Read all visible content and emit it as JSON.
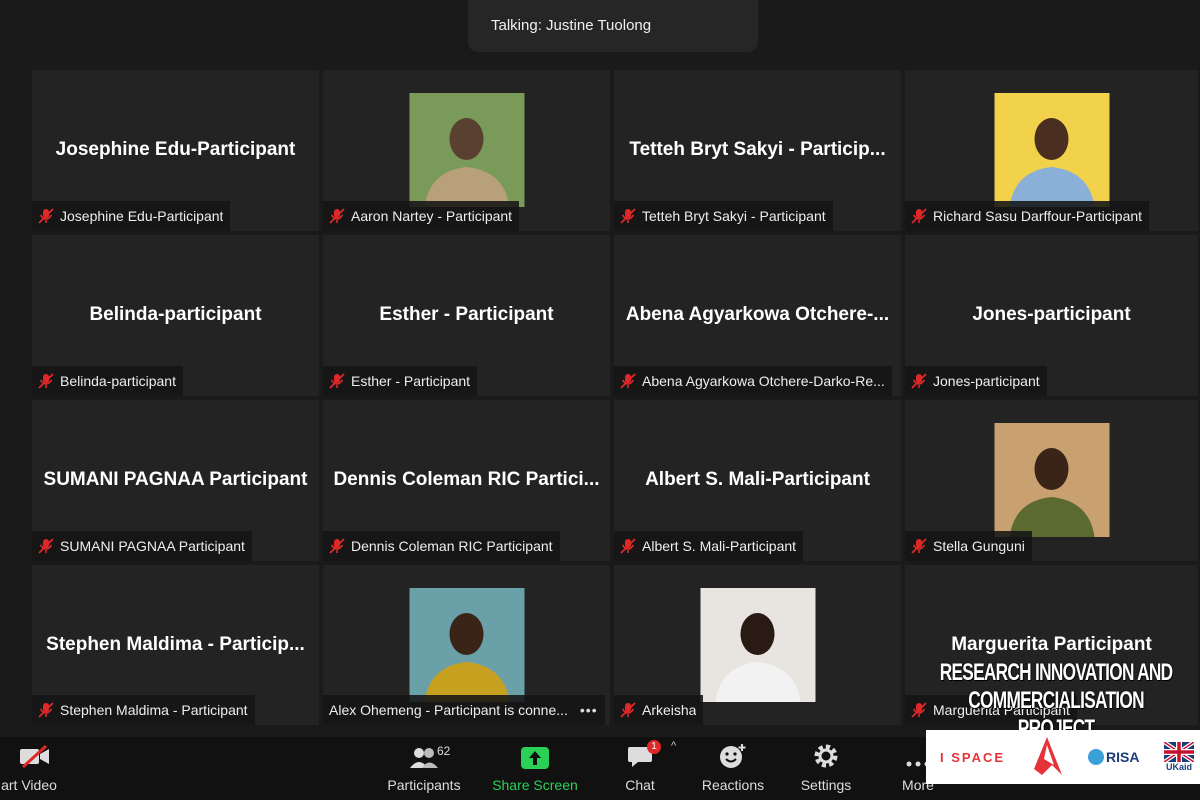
{
  "talking_label": "Talking: Justine Tuolong",
  "participants": [
    {
      "name": "Josephine Edu-Participant",
      "label": "Josephine Edu-Participant",
      "photo": false
    },
    {
      "name": "Aaron Nartey - Participant",
      "label": "Aaron Nartey - Participant",
      "photo": true,
      "photo_colors": [
        "#7a9a5a",
        "#b8a07a",
        "#5a4030"
      ]
    },
    {
      "name": "Tetteh Bryt Sakyi - Particip...",
      "label": "Tetteh Bryt Sakyi - Participant",
      "photo": false
    },
    {
      "name": "Richard Sasu Darffour-Participant",
      "label": "Richard Sasu Darffour-Participant",
      "photo": true,
      "photo_colors": [
        "#f2d24a",
        "#8ab0d8",
        "#4a2e20"
      ]
    },
    {
      "name": "Belinda-participant",
      "label": "Belinda-participant",
      "photo": false
    },
    {
      "name": "Esther - Participant",
      "label": "Esther - Participant",
      "photo": false
    },
    {
      "name": "Abena Agyarkowa Otchere-...",
      "label": "Abena Agyarkowa Otchere-Darko-Re...",
      "photo": false
    },
    {
      "name": "Jones-participant",
      "label": "Jones-participant",
      "photo": false
    },
    {
      "name": "SUMANI PAGNAA Participant",
      "label": "SUMANI PAGNAA Participant",
      "photo": false
    },
    {
      "name": "Dennis Coleman RIC Partici...",
      "label": "Dennis Coleman RIC Participant",
      "photo": false
    },
    {
      "name": "Albert S. Mali-Participant",
      "label": "Albert S. Mali-Participant",
      "photo": false
    },
    {
      "name": "Stella Gunguni",
      "label": "Stella Gunguni",
      "photo": true,
      "photo_colors": [
        "#c9a070",
        "#5a6a30",
        "#3a2418"
      ]
    },
    {
      "name": "Stephen Maldima - Particip...",
      "label": "Stephen Maldima - Participant",
      "photo": false
    },
    {
      "name": "Alex Ohemeng",
      "label": "Alex Ohemeng - Participant is conne...",
      "photo": true,
      "photo_colors": [
        "#6aa0a8",
        "#c8a020",
        "#3a2418"
      ],
      "more": "•••",
      "no_mute": true
    },
    {
      "name": "Arkeisha",
      "label": "Arkeisha",
      "photo": true,
      "photo_colors": [
        "#e8e4e0",
        "#f2f2f2",
        "#2a1a14"
      ]
    },
    {
      "name": "Marguerita Participant",
      "label": "Marguerita Participant",
      "photo": false
    }
  ],
  "toolbar": {
    "video_label": "art Video",
    "participants_label": "Participants",
    "participants_count": "62",
    "share_label": "Share Screen",
    "chat_label": "Chat",
    "chat_badge": "1",
    "reactions_label": "Reactions",
    "settings_label": "Settings",
    "more_label": "More",
    "caret": "^"
  },
  "banner": {
    "line1": "RESEARCH INNOVATION AND",
    "line2": "COMMERCIALISATION PROJECT"
  },
  "logos": {
    "ispace": "I SPACE",
    "risa": "RISA",
    "ukaid": "UKaid"
  },
  "colors": {
    "share_green": "#2bd157",
    "badge_red": "#e02828",
    "mute_red": "#e02828"
  }
}
